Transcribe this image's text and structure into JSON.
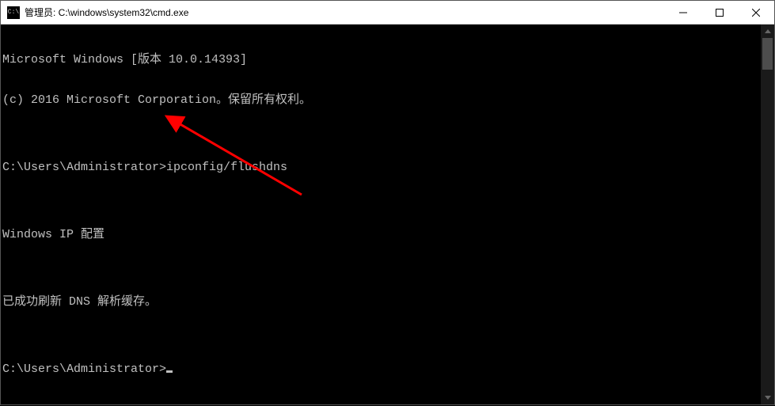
{
  "titlebar": {
    "icon_label": "C:\\",
    "title": "管理员: C:\\windows\\system32\\cmd.exe"
  },
  "terminal": {
    "lines": [
      "Microsoft Windows [版本 10.0.14393]",
      "(c) 2016 Microsoft Corporation。保留所有权利。",
      "",
      "C:\\Users\\Administrator>ipconfig/flushdns",
      "",
      "Windows IP 配置",
      "",
      "已成功刷新 DNS 解析缓存。",
      "",
      "C:\\Users\\Administrator>"
    ]
  },
  "annotation": {
    "color": "#ff0000"
  }
}
